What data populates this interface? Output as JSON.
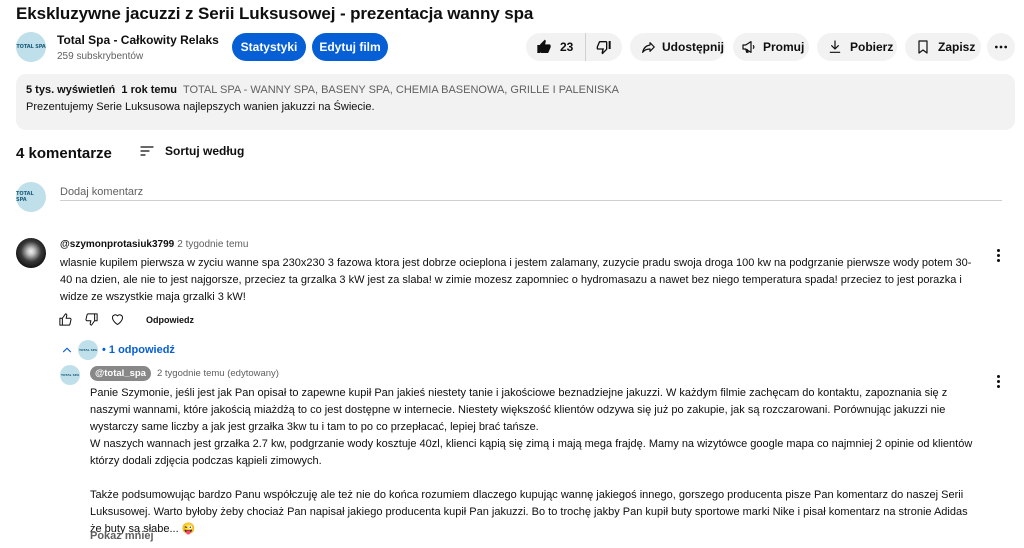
{
  "video": {
    "title": "Ekskluzywne jacuzzi z Serii Luksusowej - prezentacja wanny spa"
  },
  "channel": {
    "name": "Total Spa - Całkowity Relaks",
    "subscribers": "259 subskrybentów",
    "avatar_text": "TOTAL SPA",
    "stats_label": "Statystyki",
    "edit_label": "Edytuj film"
  },
  "actions": {
    "like_count": "23",
    "share_label": "Udostępnij",
    "promo_label": "Promuj",
    "download_label": "Pobierz",
    "save_label": "Zapisz"
  },
  "description": {
    "views": "5 tys. wyświetleń",
    "age": "1 rok temu",
    "tags": "TOTAL SPA - WANNY SPA, BASENY SPA, CHEMIA BASENOWA, GRILLE I PALENISKA",
    "text": "Prezentujemy Serie Luksusowa najlepszych wanien jakuzzi na Świecie."
  },
  "comments": {
    "count_label": "4 komentarze",
    "sort_label": "Sortuj według",
    "add_placeholder": "Dodaj komentarz",
    "reply_label": "Odpowiedz",
    "items": [
      {
        "author": "@szymonprotasiuk3799",
        "time": "2 tygodnie temu",
        "text": "wlasnie kupilem pierwsza w zyciu wanne spa 230x230 3 fazowa ktora jest dobrze ocieplona i jestem zalamany, zuzycie pradu swoja droga 100 kw na podgrzanie pierwsze wody potem  30-40 na dzien, ale nie to jest najgorsze, przeciez ta grzalka 3 kW jest za slaba! w zimie mozesz zapomniec o hydromasazu a nawet bez niego temperatura spada! przeciez to jest porazka i widze ze wszystkie maja grzalki 3 kW!",
        "replies_label": "• 1 odpowiedź"
      }
    ],
    "reply": {
      "author": "@total_spa",
      "time": "2 tygodnie temu (edytowany)",
      "para1": "Panie Szymonie, jeśli jest jak Pan opisał to zapewne kupił Pan jakieś niestety tanie i jakościowe beznadziejne jakuzzi. W każdym filmie zachęcam do kontaktu, zapoznania się z naszymi wannami, które jakością miażdżą to co jest dostępne w internecie. Niestety większość klientów odzywa się już po zakupie, jak są rozczarowani. Porównując jakuzzi nie wystarczy same liczby a jak jest grzałka 3kw tu i tam to po co przepłacać, lepiej brać tańsze.",
      "para2": "W naszych wannach jest grzałka 2.7 kw, podgrzanie wody kosztuje 40zl, klienci kąpią się zimą i mają mega frajdę. Mamy na wizytówce google mapa co najmniej 2 opinie od klientów którzy dodali zdjęcia podczas kąpieli zimowych.",
      "para3": "Także podsumowując bardzo Panu współczuję ale też nie do końca rozumiem dlaczego kupując wannę jakiegoś innego, gorszego producenta pisze Pan komentarz do naszej Serii Luksusowej. Warto byłoby żeby chociaż Pan napisał jakiego producenta kupił Pan jakuzzi. Bo to trochę jakby Pan kupił buty sportowe marki Nike i pisał komentarz na stronie Adidas że buty są słabe... 😜",
      "show_less": "Pokaż mniej"
    }
  },
  "colors": {
    "accent": "#065fd4",
    "pill_bg": "#f2f2f2",
    "muted_text": "#606060"
  }
}
